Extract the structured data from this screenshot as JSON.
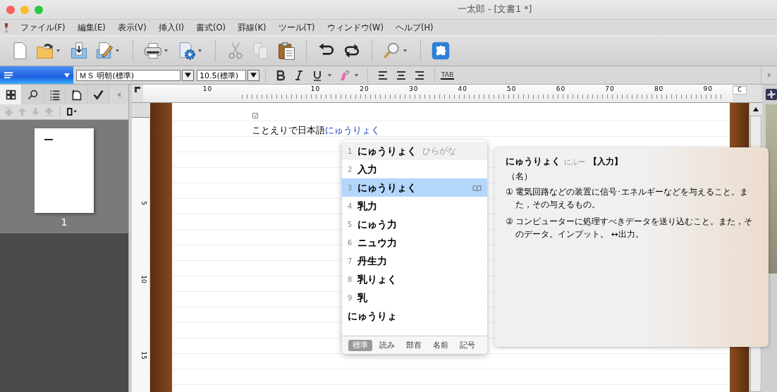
{
  "window": {
    "title": "一太郎 - [文書1 *]"
  },
  "menu": [
    "ファイル(F)",
    "編集(E)",
    "表示(V)",
    "挿入(I)",
    "書式(O)",
    "罫線(K)",
    "ツール(T)",
    "ウィンドウ(W)",
    "ヘルプ(H)"
  ],
  "toolbar": [
    [
      {
        "kind": "new",
        "dropdown": false,
        "disabled": false
      },
      {
        "kind": "open",
        "dropdown": true,
        "disabled": false
      },
      {
        "kind": "import",
        "dropdown": false,
        "disabled": false
      },
      {
        "kind": "edit",
        "dropdown": true,
        "disabled": false
      }
    ],
    [
      {
        "kind": "print",
        "dropdown": true,
        "disabled": false
      },
      {
        "kind": "settings",
        "dropdown": true,
        "disabled": false
      }
    ],
    [
      {
        "kind": "cut",
        "dropdown": false,
        "disabled": true
      },
      {
        "kind": "copy",
        "dropdown": false,
        "disabled": true
      },
      {
        "kind": "paste",
        "dropdown": false,
        "disabled": false
      }
    ],
    [
      {
        "kind": "undo",
        "dropdown": false,
        "disabled": false
      },
      {
        "kind": "redo",
        "dropdown": false,
        "disabled": false
      }
    ],
    [
      {
        "kind": "zoom",
        "dropdown": true,
        "disabled": false
      }
    ],
    [
      {
        "kind": "puzzle",
        "dropdown": false,
        "disabled": false
      }
    ]
  ],
  "format_bar": {
    "font": "ＭＳ 明朝(標準)",
    "size": "10.5(標準)",
    "tab_label": "TAB"
  },
  "sidebar": {
    "tabs": [
      {
        "kind": "thumbnails",
        "selected": true
      },
      {
        "kind": "search",
        "selected": false
      },
      {
        "kind": "outline",
        "selected": false
      },
      {
        "kind": "clip",
        "selected": false
      },
      {
        "kind": "check",
        "selected": false
      }
    ],
    "page_number": "1"
  },
  "ruler": {
    "top_labels": [
      "10",
      "10",
      "20",
      "30",
      "40",
      "50",
      "60",
      "70",
      "80",
      "90"
    ],
    "corner": "C",
    "side_labels": [
      "5",
      "10",
      "15"
    ]
  },
  "document": {
    "text": "ことえりで日本語",
    "composing": "にゅうりょく"
  },
  "candidates": {
    "items": [
      {
        "number": "1",
        "text": "にゅうりょく",
        "note": "ひらがな",
        "highlighted": true,
        "selected": false,
        "dictionary": false
      },
      {
        "number": "2",
        "text": "入力",
        "highlighted": false,
        "selected": false,
        "dictionary": false
      },
      {
        "number": "3",
        "text": "にゅうりょく",
        "highlighted": false,
        "selected": true,
        "dictionary": true
      },
      {
        "number": "4",
        "text": "乳力",
        "highlighted": false,
        "selected": false,
        "dictionary": false
      },
      {
        "number": "5",
        "text": "にゅう力",
        "highlighted": false,
        "selected": false,
        "dictionary": false
      },
      {
        "number": "6",
        "text": "ニュウ力",
        "highlighted": false,
        "selected": false,
        "dictionary": false
      },
      {
        "number": "7",
        "text": "丹生力",
        "highlighted": false,
        "selected": false,
        "dictionary": false
      },
      {
        "number": "8",
        "text": "乳りょく",
        "highlighted": false,
        "selected": false,
        "dictionary": false
      },
      {
        "number": "9",
        "text": "乳",
        "highlighted": false,
        "selected": false,
        "dictionary": false
      },
      {
        "text": "にゅうりょ",
        "highlighted": false,
        "selected": false,
        "dictionary": false
      }
    ],
    "tabs": [
      {
        "label": "標準",
        "selected": true
      },
      {
        "label": "読み",
        "selected": false
      },
      {
        "label": "部首",
        "selected": false
      },
      {
        "label": "名前",
        "selected": false
      },
      {
        "label": "記号",
        "selected": false
      }
    ]
  },
  "definition": {
    "headword": "にゅうりょく",
    "pitch": "にふー",
    "kanji": "【入力】",
    "part_of_speech": "（名）",
    "senses": [
      {
        "mark": "①",
        "text": "電気回路などの装置に信号･エネルギーなどを与えること。また，その与えるもの。"
      },
      {
        "mark": "②",
        "text": "コンピューターに処理すべきデータを送り込むこと。また，そのデータ。インプット。 ↔出力。"
      }
    ]
  }
}
